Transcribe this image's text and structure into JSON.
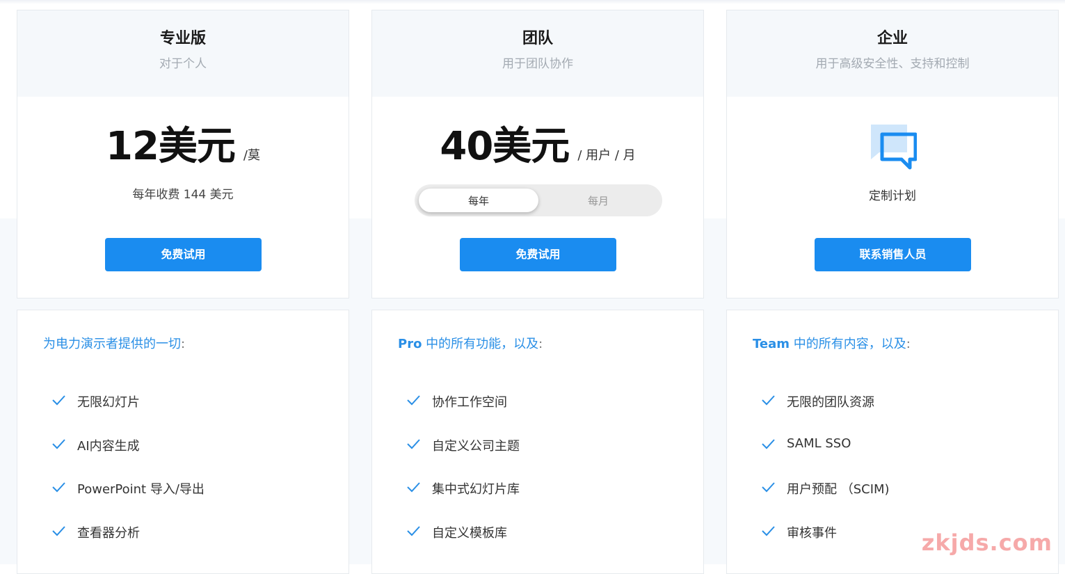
{
  "plans": [
    {
      "name": "专业版",
      "subtitle": "对于个人",
      "price": "12美元",
      "unit": "/莫",
      "billing_note": "每年收费 144 美元",
      "cta": "免费试用",
      "features_title_highlight": "为电力演示者提供的一切",
      "features_title_rest": "",
      "features_title_colon": ":",
      "features": [
        "无限幻灯片",
        "AI内容生成",
        "PowerPoint 导入/导出",
        "查看器分析"
      ]
    },
    {
      "name": "团队",
      "subtitle": "用于团队协作",
      "price": "40美元",
      "unit": "/ 用户 / 月",
      "toggle": {
        "selected": "每年",
        "other": "每月"
      },
      "cta": "免费试用",
      "features_title_highlight": "Pro",
      "features_title_rest": " 中的所有功能，以及",
      "features_title_colon": ":",
      "features": [
        "协作工作空间",
        "自定义公司主题",
        "集中式幻灯片库",
        "自定义模板库"
      ]
    },
    {
      "name": "企业",
      "subtitle": "用于高级安全性、支持和控制",
      "custom_label": "定制计划",
      "cta": "联系销售人员",
      "features_title_highlight": "Team",
      "features_title_rest": " 中的所有内容，以及",
      "features_title_colon": ":",
      "features": [
        "无限的团队资源",
        "SAML SSO",
        "用户预配 （SCIM)",
        "审核事件"
      ]
    }
  ],
  "icons": {
    "check": "check-icon",
    "custom_plan": "chat-bubble-icon"
  },
  "colors": {
    "accent": "#1a8cf0",
    "header_bg": "#f5f8fb",
    "check": "#2a8fe6"
  },
  "watermark": "zkjds.com"
}
